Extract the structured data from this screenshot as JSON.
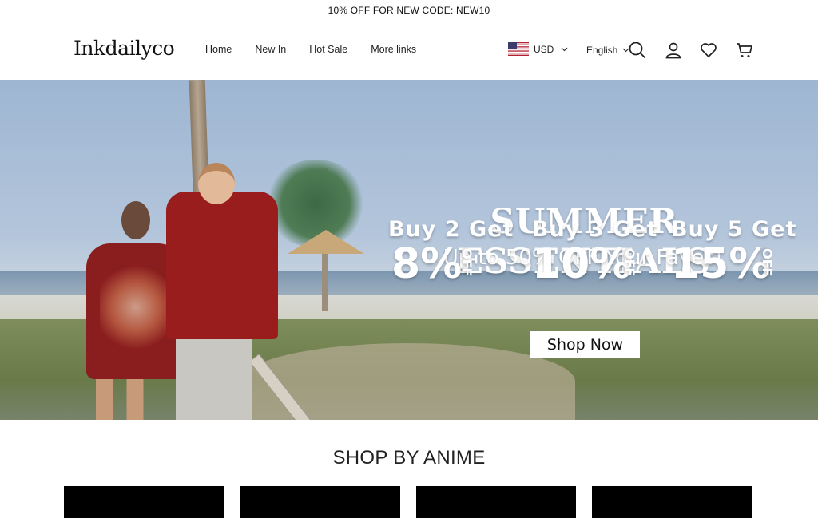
{
  "announcement": "10% OFF FOR NEW CODE: NEW10",
  "brand": "Inkdailyco",
  "nav": [
    "Home",
    "New In",
    "Hot Sale",
    "More links"
  ],
  "currency": {
    "label": "USD",
    "flag_icon": "us-flag-icon"
  },
  "language": "English",
  "hero": {
    "headline": "SUMMER ESSENTIALS",
    "subheadline": "Up to 50% OFF Your Faves!",
    "offers": [
      {
        "buy": "Buy 2 Get",
        "percent": "8%",
        "off": "OFF"
      },
      {
        "buy": "Buy 3 Get",
        "percent": "10%",
        "off": "OFF"
      },
      {
        "buy": "Buy 5 Get",
        "percent": "15%",
        "off": "OFF"
      }
    ],
    "cta": "Shop Now"
  },
  "section": {
    "title": "SHOP BY ANIME"
  },
  "colors": {
    "announcement_bg": "#ffffff",
    "button_bg": "#ffffff",
    "card_bg": "#000000"
  }
}
